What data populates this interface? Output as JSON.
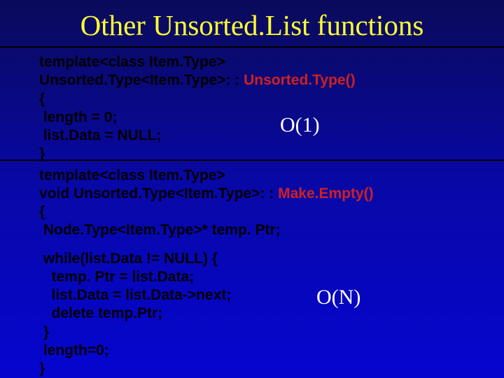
{
  "title": "Other Unsorted.List functions",
  "complexity": {
    "o1": "O(1)",
    "on": "O(N)"
  },
  "code1": {
    "l1": "template<class Item.Type>",
    "l2a": "Unsorted.Type<Item.Type>: : ",
    "l2b": "Unsorted.Type()",
    "l3": "{",
    "l4": " length = 0;",
    "l5": " list.Data = NULL;",
    "l6": "}"
  },
  "code2": {
    "l1": "template<class Item.Type>",
    "l2a": "void Unsorted.Type<Item.Type>: : ",
    "l2b": "Make.Empty()",
    "l3": "{",
    "l4": " Node.Type<Item.Type>* temp. Ptr;"
  },
  "code3": {
    "l1": " while(list.Data != NULL) {",
    "l2": "   temp. Ptr = list.Data;",
    "l3": "   list.Data = list.Data->next;",
    "l4": "   delete temp.Ptr;",
    "l5": " }",
    "l6": " length=0;",
    "l7": "}"
  }
}
